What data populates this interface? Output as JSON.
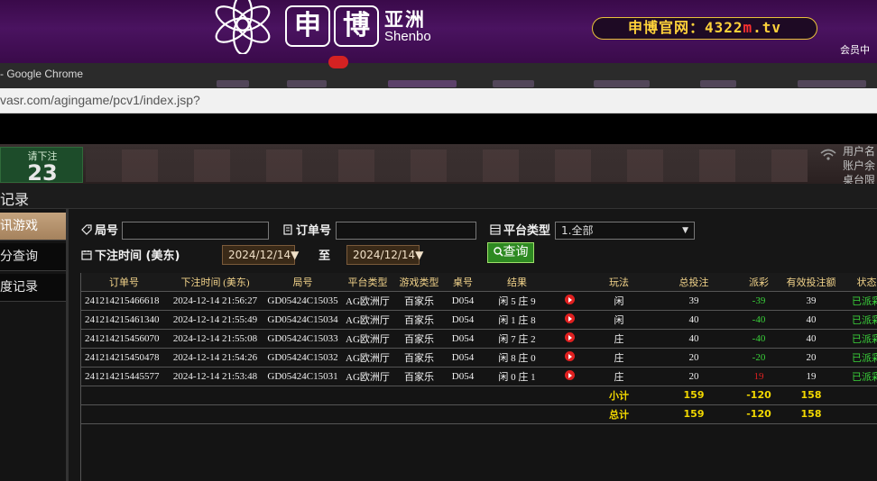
{
  "banner": {
    "brand_cn": "申博",
    "brand_char1": "申",
    "brand_char2": "博",
    "brand_region": "亚洲",
    "brand_en": "Shenbo",
    "official_site_prefix": "申博官网：4322",
    "official_site_m": "m",
    "official_site_suffix": ".tv",
    "member_center": "会员中"
  },
  "browser": {
    "title": "- Google Chrome",
    "url": "vasr.com/agingame/pcv1/index.jsp?"
  },
  "game_strip": {
    "bet_label": "请下注",
    "bet_countdown": "23",
    "user_info": [
      "用户名",
      "账户余",
      "桌台限"
    ]
  },
  "records": {
    "title": "记录",
    "sidebar": [
      {
        "label": "讯游戏"
      },
      {
        "label": "分查询"
      },
      {
        "label": "度记录"
      }
    ],
    "filters": {
      "round_label": "局号",
      "round_value": "",
      "order_label": "订单号",
      "order_value": "",
      "platform_label": "平台类型",
      "platform_value": "1.全部",
      "time_label": "下注时间 (美东)",
      "date_from": "2024/12/14▼",
      "to_label": "至",
      "date_to": "2024/12/14▼",
      "query_button": "查询"
    },
    "table": {
      "headers": [
        "订单号",
        "下注时间 (美东)",
        "局号",
        "平台类型",
        "游戏类型",
        "桌号",
        "结果",
        "",
        "玩法",
        "总投注",
        "派彩",
        "有效投注额",
        "状态"
      ],
      "rows": [
        {
          "order": "241214215466618",
          "time": "2024-12-14 21:56:27",
          "round": "GD05424C15035",
          "platform": "AG欧洲厅",
          "game": "百家乐",
          "table": "D054",
          "result": "闲 5 庄 9",
          "play": "闲",
          "bet": "39",
          "payout": "-39",
          "payout_color": "#3ad23a",
          "valid": "39",
          "status": "已派彩"
        },
        {
          "order": "241214215461340",
          "time": "2024-12-14 21:55:49",
          "round": "GD05424C15034",
          "platform": "AG欧洲厅",
          "game": "百家乐",
          "table": "D054",
          "result": "闲 1 庄 8",
          "play": "闲",
          "bet": "40",
          "payout": "-40",
          "payout_color": "#3ad23a",
          "valid": "40",
          "status": "已派彩"
        },
        {
          "order": "241214215456070",
          "time": "2024-12-14 21:55:08",
          "round": "GD05424C15033",
          "platform": "AG欧洲厅",
          "game": "百家乐",
          "table": "D054",
          "result": "闲 7 庄 2",
          "play": "庄",
          "bet": "40",
          "payout": "-40",
          "payout_color": "#3ad23a",
          "valid": "40",
          "status": "已派彩"
        },
        {
          "order": "241214215450478",
          "time": "2024-12-14 21:54:26",
          "round": "GD05424C15032",
          "platform": "AG欧洲厅",
          "game": "百家乐",
          "table": "D054",
          "result": "闲 8 庄 0",
          "play": "庄",
          "bet": "20",
          "payout": "-20",
          "payout_color": "#3ad23a",
          "valid": "20",
          "status": "已派彩"
        },
        {
          "order": "241214215445577",
          "time": "2024-12-14 21:53:48",
          "round": "GD05424C15031",
          "platform": "AG欧洲厅",
          "game": "百家乐",
          "table": "D054",
          "result": "闲 0 庄 1",
          "play": "庄",
          "bet": "20",
          "payout": "19",
          "payout_color": "#e02020",
          "valid": "19",
          "status": "已派彩"
        }
      ],
      "subtotal": {
        "label": "小计",
        "bet": "159",
        "payout": "-120",
        "valid": "158"
      },
      "total": {
        "label": "总计",
        "bet": "159",
        "payout": "-120",
        "valid": "158"
      },
      "status_color": "#3ad23a"
    }
  }
}
